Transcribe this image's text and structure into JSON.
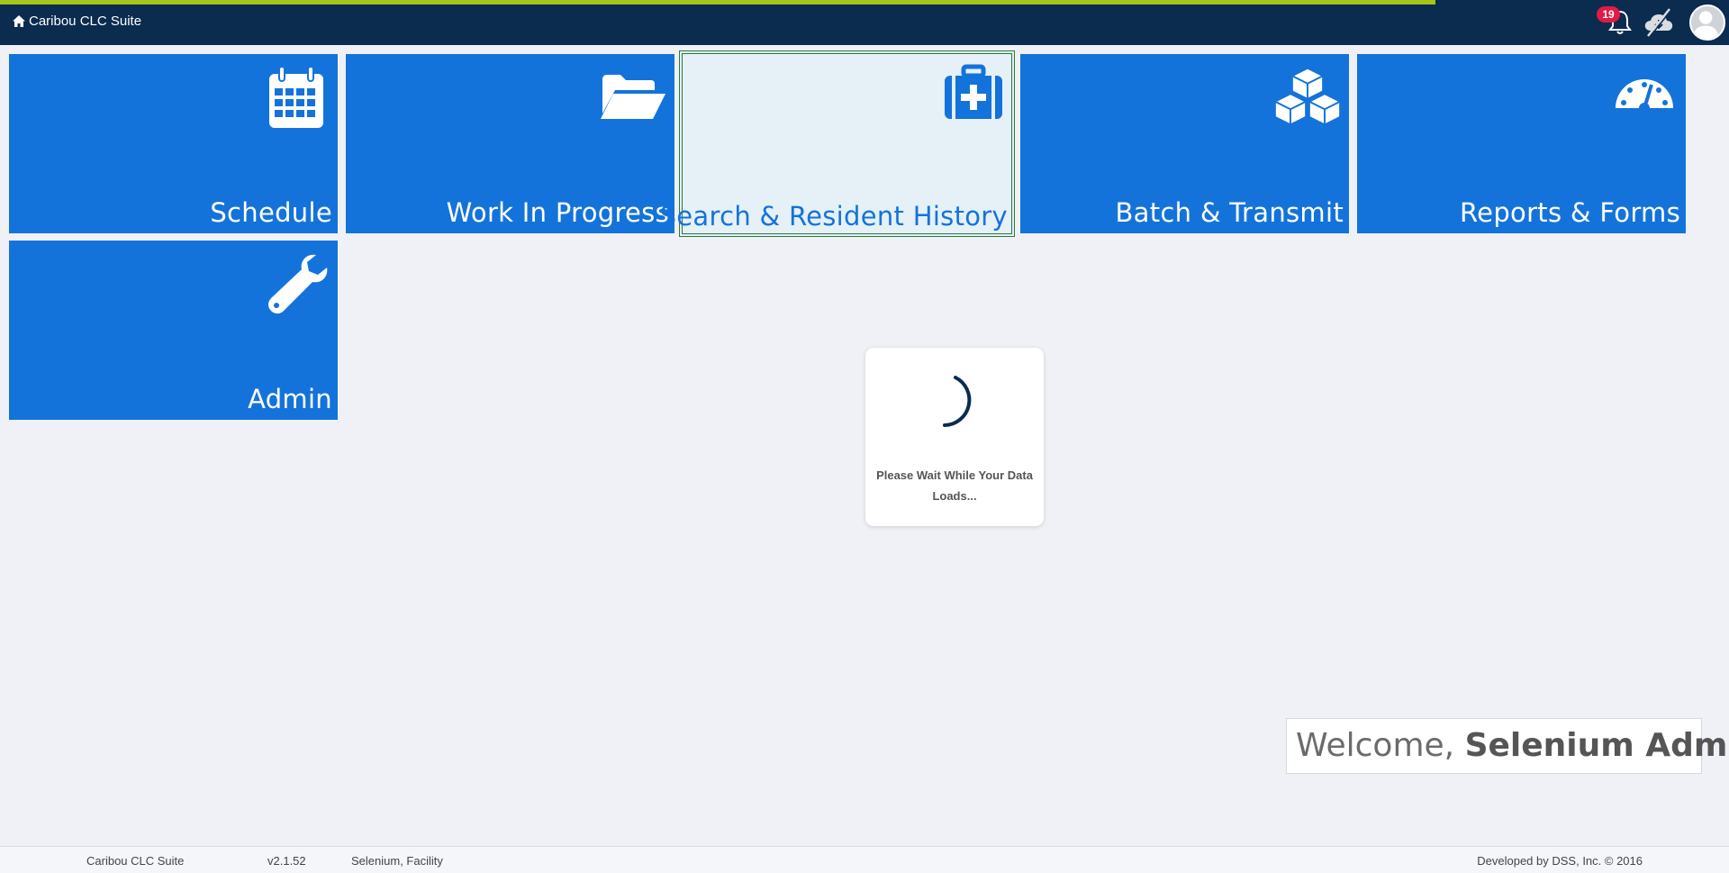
{
  "header": {
    "app_title": "Caribou CLC Suite",
    "notification_count": "19",
    "brand_icon": "home-icon",
    "icons": [
      "bell-icon",
      "cloud-download-disabled-icon",
      "user-avatar"
    ]
  },
  "tiles": [
    {
      "label": "Schedule",
      "icon": "calendar-icon"
    },
    {
      "label": "Work In Progress",
      "icon": "folder-open-icon"
    },
    {
      "label": "Search & Resident History",
      "icon": "medkit-icon",
      "active": true
    },
    {
      "label": "Batch & Transmit",
      "icon": "cubes-icon"
    },
    {
      "label": "Reports & Forms",
      "icon": "dashboard-icon"
    },
    {
      "label": "Admin",
      "icon": "wrench-icon"
    }
  ],
  "loading": {
    "message": "Please Wait While Your Data Loads..."
  },
  "welcome": {
    "prefix": "Welcome, ",
    "name": "Selenium Admin"
  },
  "footer": {
    "app_name": "Caribou CLC Suite",
    "version": "v2.1.52",
    "facility": "Selenium, Facility",
    "credits": "Developed by DSS, Inc. © 2016"
  },
  "colors": {
    "header_bg": "#0b2b4f",
    "progress_accent": "#a6c61a",
    "tile_blue": "#1473da",
    "active_tile_bg": "#e5f0f7",
    "active_tile_border": "#2b7a3a",
    "badge_red": "#e01b45",
    "page_bg": "#eff1f6"
  }
}
